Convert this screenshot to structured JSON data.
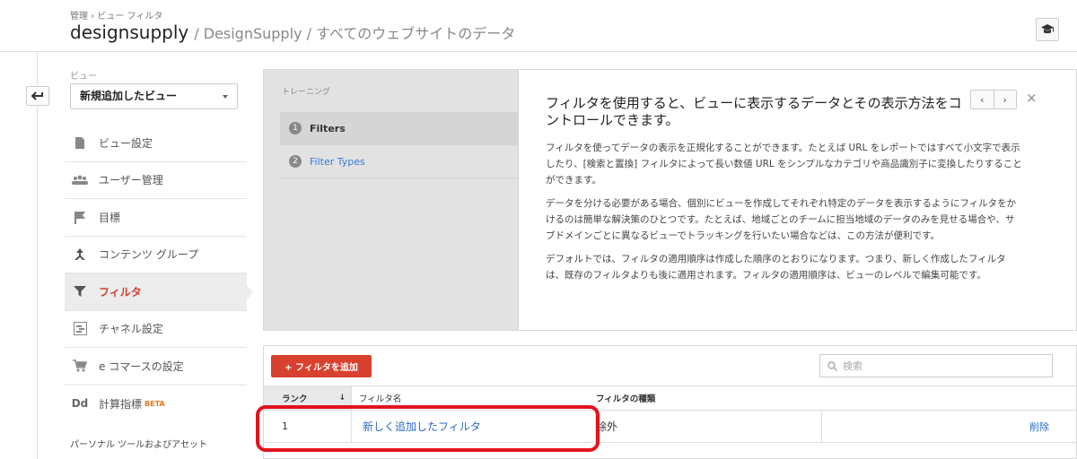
{
  "header": {
    "breadcrumb": "管理 › ビュー フィルタ",
    "account": "designsupply",
    "sub_title": "/ DesignSupply / すべてのウェブサイトのデータ",
    "help_icon": "graduation-cap-icon"
  },
  "sidebar": {
    "view_label": "ビュー",
    "view_select": "新規追加したビュー",
    "items": [
      {
        "label": "ビュー設定",
        "icon": "document-icon"
      },
      {
        "label": "ユーザー管理",
        "icon": "users-icon"
      },
      {
        "label": "目標",
        "icon": "flag-icon"
      },
      {
        "label": "コンテンツ グループ",
        "icon": "content-group-icon"
      },
      {
        "label": "フィルタ",
        "icon": "filter-icon",
        "active": true
      },
      {
        "label": "チャネル設定",
        "icon": "channel-icon"
      },
      {
        "label": "e コマースの設定",
        "icon": "cart-icon"
      },
      {
        "label": "計算指標",
        "icon": "dd-icon",
        "badge": "BETA"
      }
    ],
    "section_heading": "パーソナル ツールおよびアセット"
  },
  "training": {
    "label": "トレーニング",
    "steps": [
      {
        "num": "1",
        "label": "Filters"
      },
      {
        "num": "2",
        "label": "Filter Types"
      }
    ],
    "heading": "フィルタを使用すると、ビューに表示するデータとその表示方法をコントロールできます。",
    "paragraphs": [
      "フィルタを使ってデータの表示を正規化することができます。たとえば URL をレポートではすべて小文字で表示したり、[検索と置換] フィルタによって長い数値 URL をシンプルなカテゴリや商品識別子に変換したりすることができます。",
      "データを分ける必要がある場合、個別にビューを作成してそれぞれ特定のデータを表示するようにフィルタをかけるのは簡単な解決策のひとつです。たとえば、地域ごとのチームに担当地域のデータのみを見せる場合や、サブドメインごとに異なるビューでトラッキングを行いたい場合などは、この方法が便利です。",
      "デフォルトでは、フィルタの適用順序は作成した順序のとおりになります。つまり、新しく作成したフィルタは、既存のフィルタよりも後に適用されます。フィルタの適用順序は、ビューのレベルで編集可能です。"
    ],
    "pager_prev": "‹",
    "pager_next": "›",
    "close": "×"
  },
  "filters": {
    "add_button": "+ フィルタを追加",
    "search_placeholder": "検索",
    "columns": {
      "rank": "ランク",
      "name": "フィルタ名",
      "type": "フィルタの種類"
    },
    "sort_arrow": "↓",
    "rows": [
      {
        "rank": "1",
        "name": "新しく追加したフィルタ",
        "type": "除外",
        "action": "削除"
      }
    ]
  },
  "colors": {
    "accent_red": "#d8412f",
    "link_blue": "#2a6ac8",
    "highlight": "#e3131d"
  }
}
